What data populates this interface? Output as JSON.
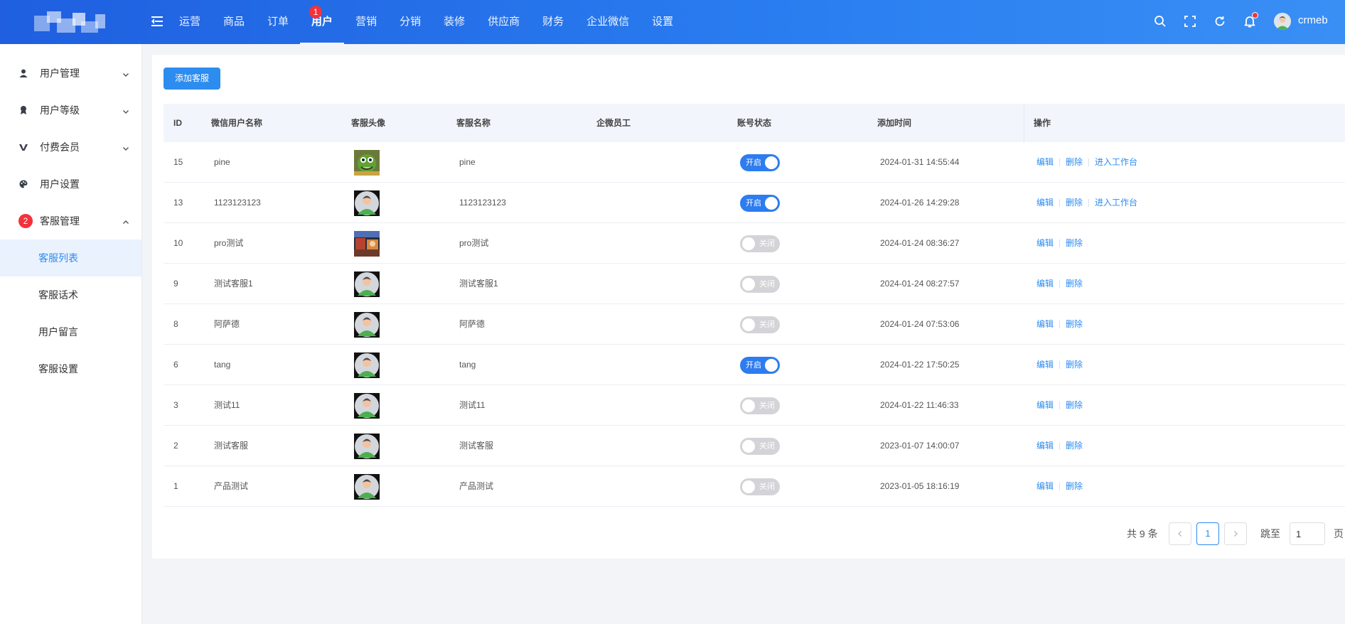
{
  "header": {
    "nav": [
      {
        "label": "运营",
        "active": false
      },
      {
        "label": "商品",
        "active": false
      },
      {
        "label": "订单",
        "active": false
      },
      {
        "label": "用户",
        "active": true,
        "badge": "1"
      },
      {
        "label": "营销",
        "active": false
      },
      {
        "label": "分销",
        "active": false
      },
      {
        "label": "装修",
        "active": false
      },
      {
        "label": "供应商",
        "active": false
      },
      {
        "label": "财务",
        "active": false
      },
      {
        "label": "企业微信",
        "active": false
      },
      {
        "label": "设置",
        "active": false
      }
    ],
    "username": "crmeb"
  },
  "sidebar": {
    "groups": [
      {
        "label": "用户管理",
        "icon": "user-icon",
        "expanded": false
      },
      {
        "label": "用户等级",
        "icon": "level-icon",
        "expanded": false
      },
      {
        "label": "付费会员",
        "icon": "vip-icon",
        "expanded": false
      },
      {
        "label": "用户设置",
        "icon": "palette-icon"
      },
      {
        "label": "客服管理",
        "badge": "2",
        "expanded": true
      }
    ],
    "sub_items": [
      {
        "label": "客服列表",
        "active": true
      },
      {
        "label": "客服话术",
        "active": false
      },
      {
        "label": "用户留言",
        "active": false
      },
      {
        "label": "客服设置",
        "active": false
      }
    ]
  },
  "main": {
    "add_button": "添加客服",
    "columns": [
      "ID",
      "微信用户名称",
      "客服头像",
      "客服名称",
      "企微员工",
      "账号状态",
      "添加时间",
      "操作"
    ],
    "switch_on_label": "开启",
    "switch_off_label": "关闭",
    "op_labels": {
      "edit": "编辑",
      "delete": "删除",
      "workbench": "进入工作台"
    },
    "rows": [
      {
        "id": "15",
        "wechat_name": "pine",
        "avatar": "custom-green",
        "name": "pine",
        "staff": "",
        "status": true,
        "time": "2024-01-31 14:55:44",
        "workbench": true
      },
      {
        "id": "13",
        "wechat_name": "1123123123",
        "avatar": "default",
        "name": "1123123123",
        "staff": "",
        "status": true,
        "time": "2024-01-26 14:29:28",
        "workbench": true
      },
      {
        "id": "10",
        "wechat_name": "pro测试",
        "avatar": "custom-photo",
        "name": "pro测试",
        "staff": "",
        "status": false,
        "time": "2024-01-24 08:36:27",
        "workbench": false
      },
      {
        "id": "9",
        "wechat_name": "测试客服1",
        "avatar": "default",
        "name": "测试客服1",
        "staff": "",
        "status": false,
        "time": "2024-01-24 08:27:57",
        "workbench": false
      },
      {
        "id": "8",
        "wechat_name": "阿萨德",
        "avatar": "default",
        "name": "阿萨德",
        "staff": "",
        "status": false,
        "time": "2024-01-24 07:53:06",
        "workbench": false
      },
      {
        "id": "6",
        "wechat_name": "tang",
        "avatar": "default",
        "name": "tang",
        "staff": "",
        "status": true,
        "time": "2024-01-22 17:50:25",
        "workbench": false
      },
      {
        "id": "3",
        "wechat_name": "测试11",
        "avatar": "default",
        "name": "测试11",
        "staff": "",
        "status": false,
        "time": "2024-01-22 11:46:33",
        "workbench": false
      },
      {
        "id": "2",
        "wechat_name": "测试客服",
        "avatar": "default",
        "name": "测试客服",
        "staff": "",
        "status": false,
        "time": "2023-01-07 14:00:07",
        "workbench": false
      },
      {
        "id": "1",
        "wechat_name": "产品测试",
        "avatar": "default",
        "name": "产品测试",
        "staff": "",
        "status": false,
        "time": "2023-01-05 18:16:19",
        "workbench": false
      }
    ]
  },
  "pagination": {
    "total": "共 9 条",
    "current": "1",
    "jump_label": "跳至",
    "jump_value": "1",
    "page_suffix": "页"
  },
  "colors": {
    "primary": "#2d8cf0",
    "header": "#2a7ef0",
    "badge": "#f5313a"
  }
}
